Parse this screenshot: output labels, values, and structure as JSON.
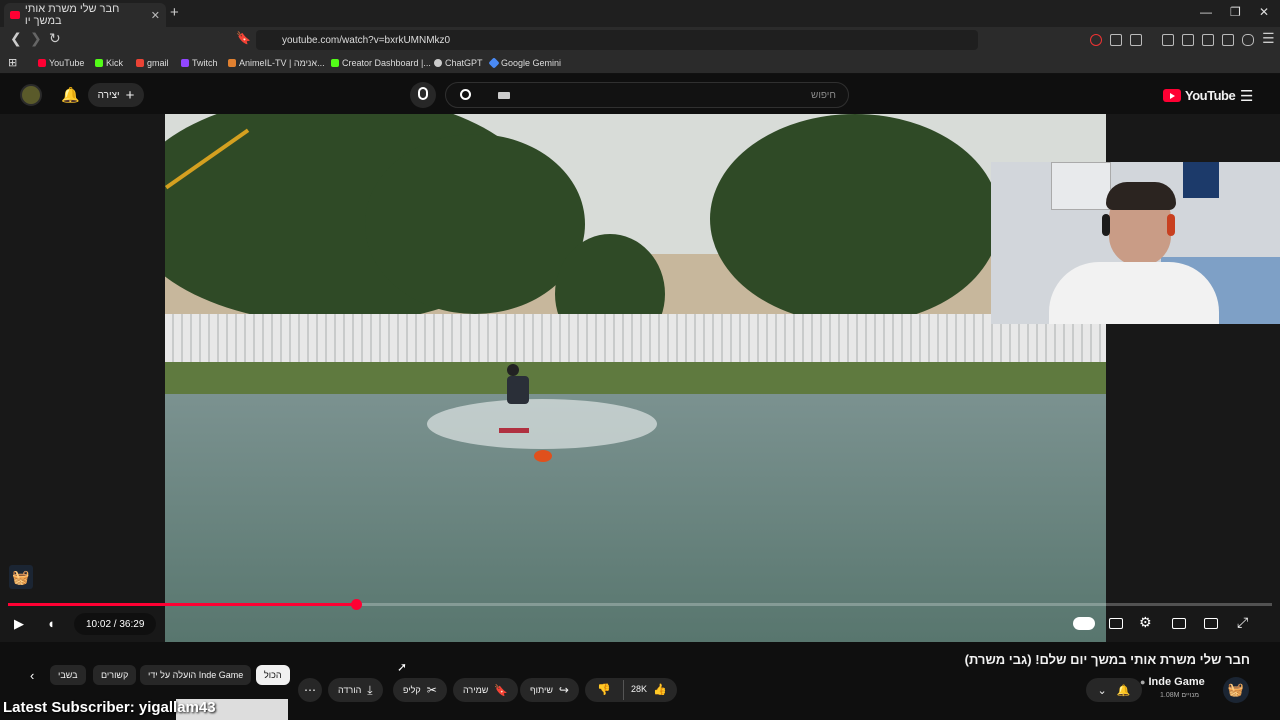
{
  "browser": {
    "tab_title": "חבר שלי משרת אותי במשך יו",
    "tab_close": "✕",
    "new_tab": "+",
    "url": "youtube.com/watch?v=bxrkUMNMkz0",
    "window_controls": [
      "—",
      "❐",
      "✕"
    ],
    "bookmarks": [
      {
        "label": "YouTube",
        "color": "#ff0033"
      },
      {
        "label": "Kick",
        "color": "#53fc18"
      },
      {
        "label": "gmail",
        "color": "#ea4335"
      },
      {
        "label": "Twitch",
        "color": "#9146ff"
      },
      {
        "label": "AnimeIL-TV | אנימה...",
        "color": "#e08030"
      },
      {
        "label": "Creator Dashboard |...",
        "color": "#53fc18"
      },
      {
        "label": "ChatGPT",
        "color": "#cccccc"
      },
      {
        "label": "Google Gemini",
        "color": "#4a8af4"
      }
    ]
  },
  "youtube": {
    "create_label": "יצירה",
    "search_placeholder": "חיפוש",
    "logo_text": "YouTube"
  },
  "player": {
    "current_time": "10:02",
    "duration": "36:29",
    "time_display": "10:02 / 36:29",
    "progress_fraction": 0.275,
    "accent": "#ff0033"
  },
  "video": {
    "title": "חבר שלי משרת אותי במשך יום שלם! (גבי משרת)",
    "channel": "Inde Game",
    "subscribers": "1.08M מנויים",
    "likes": "28K",
    "actions": {
      "share": "שיתוף",
      "save": "שמירה",
      "clip": "קליפ",
      "download": "הורדה"
    }
  },
  "chips": {
    "all": "הכול",
    "uploaded_by": "הועלה על ידי Inde Game",
    "related": "קשורים",
    "recent": "בשבי"
  },
  "overlay": {
    "latest_subscriber": "Latest Subscriber: yigallam43"
  }
}
